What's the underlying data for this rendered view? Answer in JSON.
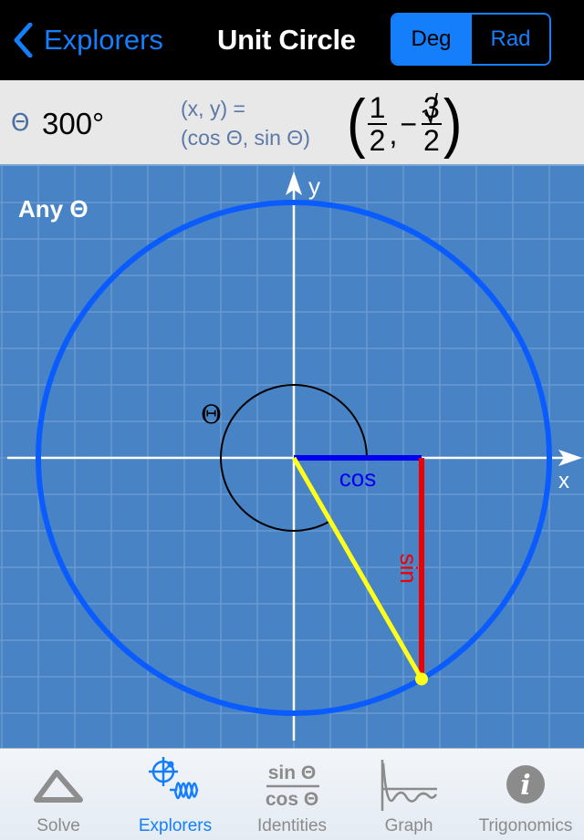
{
  "navbar": {
    "back_label": "Explorers",
    "title": "Unit Circle",
    "mode_options": [
      "Deg",
      "Rad"
    ],
    "mode_selected": "Deg"
  },
  "info": {
    "theta_symbol": "Θ",
    "theta_value": "300°",
    "xy_line1": "(x, y) =",
    "xy_line2": "(cos Θ, sin Θ)",
    "coord_x_num": "1",
    "coord_x_den": "2",
    "coord_y_sign": "−",
    "coord_y_num": "3",
    "coord_y_den": "2",
    "open_paren": "(",
    "close_paren": ")",
    "comma": ","
  },
  "diagram": {
    "mode_label": "Any Θ",
    "angle_degrees": 300,
    "angle_label": "Θ",
    "x_axis_label": "x",
    "y_axis_label": "y",
    "cos_label": "cos",
    "sin_label": "sin",
    "colors": {
      "background": "#4783c5",
      "grid": "#6a9ad0",
      "circle": "#0a5cff",
      "radius": "#ffff1a",
      "cos": "#0000ee",
      "sin": "#ee0000",
      "axis": "#ffffff",
      "angle_arc": "#000000"
    }
  },
  "tabs": [
    {
      "label": "Solve",
      "icon": "triangle-icon",
      "active": false
    },
    {
      "label": "Explorers",
      "icon": "unit-circle-wave-icon",
      "active": true
    },
    {
      "label": "Identities",
      "icon": "sin-over-cos-icon",
      "active": false,
      "icon_num": "sin Θ",
      "icon_den": "cos Θ"
    },
    {
      "label": "Graph",
      "icon": "damped-wave-icon",
      "active": false
    },
    {
      "label": "Trigonomics",
      "icon": "info-icon",
      "active": false,
      "icon_glyph": "i"
    }
  ],
  "accent_color": "#157efb"
}
